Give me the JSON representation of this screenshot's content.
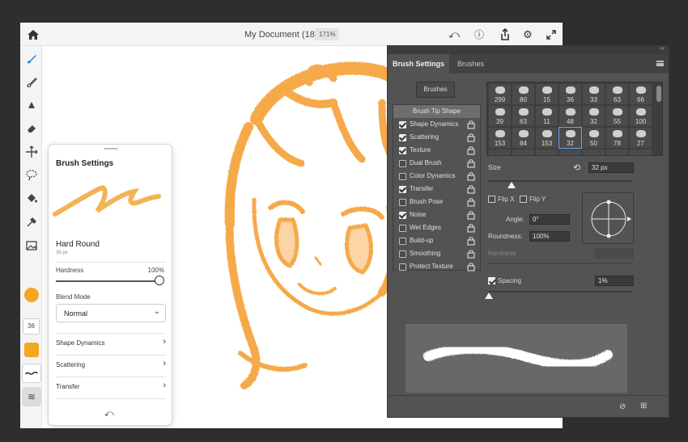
{
  "document": {
    "title": "My Document (18)",
    "zoom": "171%"
  },
  "popover": {
    "title": "Brush Settings",
    "brush_name": "Hard Round",
    "brush_size": "36 px",
    "hardness_label": "Hardness",
    "hardness_value": "100%",
    "blend_mode_label": "Blend Mode",
    "blend_mode_value": "Normal",
    "sections": [
      "Shape Dynamics",
      "Scattering",
      "Transfer"
    ]
  },
  "toolbar": {
    "size_value": "36",
    "color_hex": "#f5a623"
  },
  "ps_panel": {
    "tabs": [
      "Brush Settings",
      "Brushes"
    ],
    "brushes_button": "Brushes",
    "list_header": "Brush Tip Shape",
    "list": [
      {
        "label": "Shape Dynamics",
        "checked": true
      },
      {
        "label": "Scattering",
        "checked": true
      },
      {
        "label": "Texture",
        "checked": true
      },
      {
        "label": "Dual Brush",
        "checked": false
      },
      {
        "label": "Color Dynamics",
        "checked": false
      },
      {
        "label": "Transfer",
        "checked": true
      },
      {
        "label": "Brush Pose",
        "checked": false
      },
      {
        "label": "Noise",
        "checked": true
      },
      {
        "label": "Wet Edges",
        "checked": false
      },
      {
        "label": "Build-up",
        "checked": false
      },
      {
        "label": "Smoothing",
        "checked": false
      },
      {
        "label": "Protect Texture",
        "checked": false
      }
    ],
    "tips": [
      "299",
      "80",
      "15",
      "36",
      "33",
      "63",
      "66",
      "39",
      "63",
      "11",
      "48",
      "32",
      "55",
      "100",
      "153",
      "84",
      "153",
      "32",
      "50",
      "78",
      "27"
    ],
    "selected_tip_index": 17,
    "size_label": "Size",
    "size_value": "32 px",
    "flip_x": "Flip X",
    "flip_y": "Flip Y",
    "angle_label": "Angle:",
    "angle_value": "0°",
    "roundness_label": "Roundness:",
    "roundness_value": "100%",
    "hardness_label": "Hardness",
    "spacing_label": "Spacing",
    "spacing_value": "1%"
  }
}
